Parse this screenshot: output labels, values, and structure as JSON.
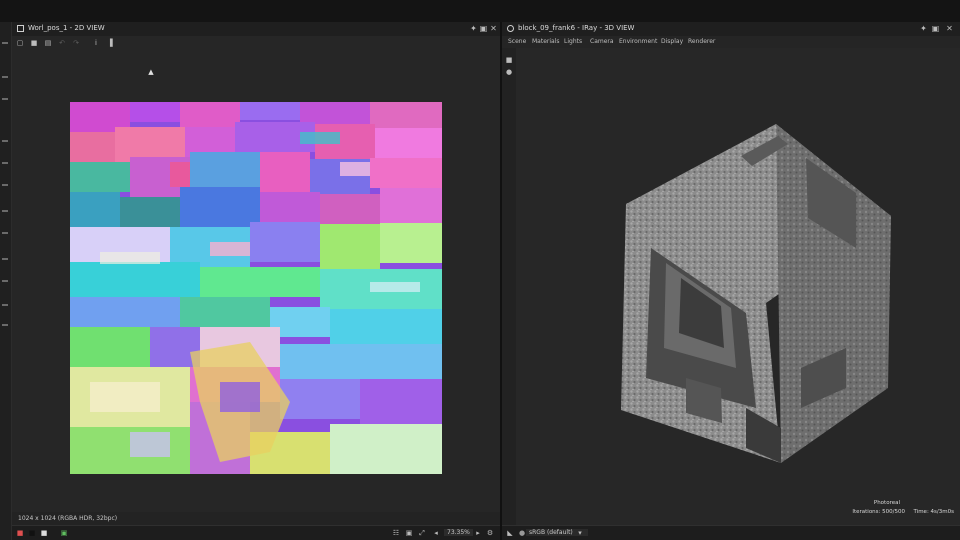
{
  "left_panel": {
    "title": "Worl_pos_1 - 2D VIEW",
    "image_info": "1024 x 1024 (RGBA HDR, 32bpc)",
    "zoom": "73.35%",
    "toolbar_icons": [
      "fit-icon",
      "save-icon",
      "copy-icon",
      "undo-icon",
      "redo-icon",
      "info-icon",
      "histogram-icon"
    ]
  },
  "right_panel": {
    "title": "block_09_frank6 - IRay - 3D VIEW",
    "menu": [
      "Scene",
      "Materials",
      "Lights",
      "Camera",
      "Environment",
      "Display",
      "Renderer"
    ],
    "render_mode": "Photoreal",
    "iterations": "Iterations: 500/500",
    "time": "Time: 4s/3m0s",
    "color_space": "sRGB (default)"
  },
  "colors": {
    "background": "#1c1c1c",
    "panel": "#232323",
    "text": "#cfcfcf"
  }
}
